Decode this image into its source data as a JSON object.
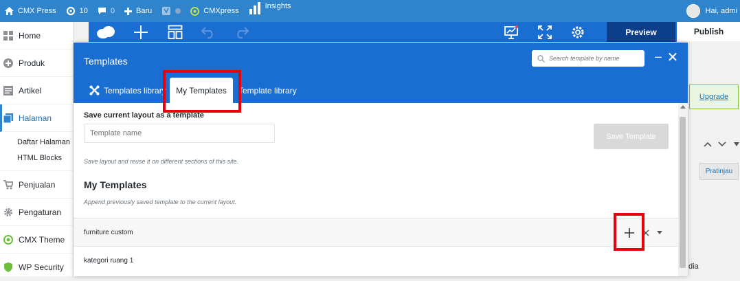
{
  "adminbar": {
    "site": "CMX Press",
    "updates": "10",
    "comments": "0",
    "new_label": "Baru",
    "cmx_label": "CMXpress",
    "insights_label": "Insights",
    "greeting": "Hai, admi"
  },
  "sidebar": {
    "items": [
      {
        "label": "Home",
        "icon": "dashboard-icon"
      },
      {
        "label": "Produk",
        "icon": "plus-circle-icon"
      },
      {
        "label": "Artikel",
        "icon": "post-icon"
      },
      {
        "label": "Halaman",
        "icon": "page-icon",
        "active": true
      },
      {
        "label": "Penjualan",
        "icon": "cart-icon"
      },
      {
        "label": "Pengaturan",
        "icon": "gear-icon"
      },
      {
        "label": "CMX Theme",
        "icon": "cmx-icon"
      },
      {
        "label": "WP Security",
        "icon": "shield-icon"
      }
    ],
    "submenu": [
      "Daftar Halaman",
      "HTML Blocks"
    ]
  },
  "toolbar": {
    "preview_label": "Preview",
    "publish_label": "Publish"
  },
  "background": {
    "upgrade_label": "Upgrade",
    "pratinjau_label": "Pratinjau",
    "partial_text": "dia"
  },
  "modal": {
    "title": "Templates",
    "search_placeholder": "Search template by name",
    "tabs": [
      "Templates library",
      "My Templates",
      "Template library"
    ],
    "active_tab": "My Templates",
    "save_section_title": "Save current layout as a template",
    "template_name_placeholder": "Template name",
    "save_button_label": "Save Template",
    "save_hint": "Save layout and reuse it on different sections of this site.",
    "my_templates_title": "My Templates",
    "my_templates_hint": "Append previously saved template to the current layout.",
    "templates": [
      {
        "name": "furniture custom"
      },
      {
        "name": "kategori ruang 1"
      }
    ]
  },
  "colors": {
    "adminbar": "#2f84cb",
    "builder_blue": "#1b6ed1",
    "preview_dark": "#0d3f8a",
    "highlight_red": "#e8000b"
  }
}
